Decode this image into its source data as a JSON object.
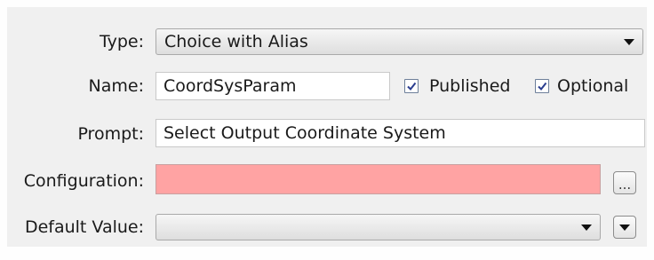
{
  "type": {
    "label": "Type:",
    "value": "Choice with Alias"
  },
  "name": {
    "label": "Name:",
    "value": "CoordSysParam",
    "published": {
      "label": "Published",
      "checked": true
    },
    "optional": {
      "label": "Optional",
      "checked": true
    }
  },
  "prompt": {
    "label": "Prompt:",
    "value": "Select Output Coordinate System"
  },
  "configuration": {
    "label": "Configuration:",
    "value": "",
    "browse_label": "...",
    "invalid_color": "#ffa3a3"
  },
  "default_value": {
    "label": "Default Value:",
    "value": ""
  }
}
